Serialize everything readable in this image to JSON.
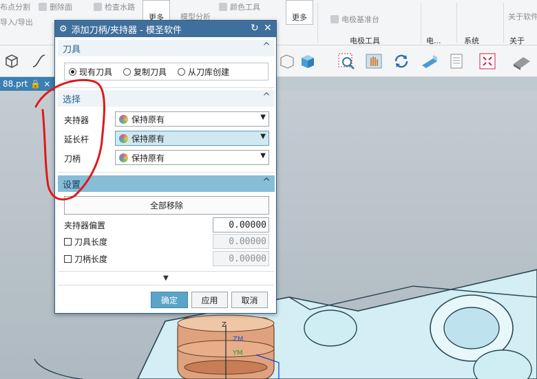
{
  "ribbon": {
    "items": [
      "布点分割",
      "删除面",
      "检查水路",
      "导入/导出",
      "颜色工具",
      "模型分析",
      "更多",
      "更多"
    ],
    "groups": [
      "电极工具",
      "电...",
      "系统",
      "关于"
    ],
    "right_items": [
      "电极基准台",
      "关于软件"
    ]
  },
  "tab": {
    "label": "88.prt"
  },
  "dialog": {
    "title": "添加刀柄/夹持器 - 模圣软件",
    "sections": {
      "tool": "刀具",
      "select": "选择",
      "settings": "设置"
    },
    "radios": [
      {
        "label": "现有刀具",
        "checked": true
      },
      {
        "label": "复制刀具",
        "checked": false
      },
      {
        "label": "从刀库创建",
        "checked": false
      }
    ],
    "selects": [
      {
        "label": "夹持器",
        "value": "保持原有"
      },
      {
        "label": "延长杆",
        "value": "保持原有"
      },
      {
        "label": "刀柄",
        "value": "保持原有"
      }
    ],
    "remove_all": "全部移除",
    "fields": [
      {
        "label": "夹持器偏置",
        "value": "0.00000"
      },
      {
        "label": "刀具长度",
        "value": "0.00000"
      },
      {
        "label": "刀柄长度",
        "value": "0.00000"
      }
    ],
    "buttons": {
      "ok": "确定",
      "apply": "应用",
      "cancel": "取消"
    }
  },
  "viewport": {
    "axis_labels": [
      "ZM",
      "YM"
    ]
  },
  "colors": {
    "title_bar": "#3f6f9c",
    "section_highlight": "#87bdd7",
    "annotation": "#e01818"
  }
}
